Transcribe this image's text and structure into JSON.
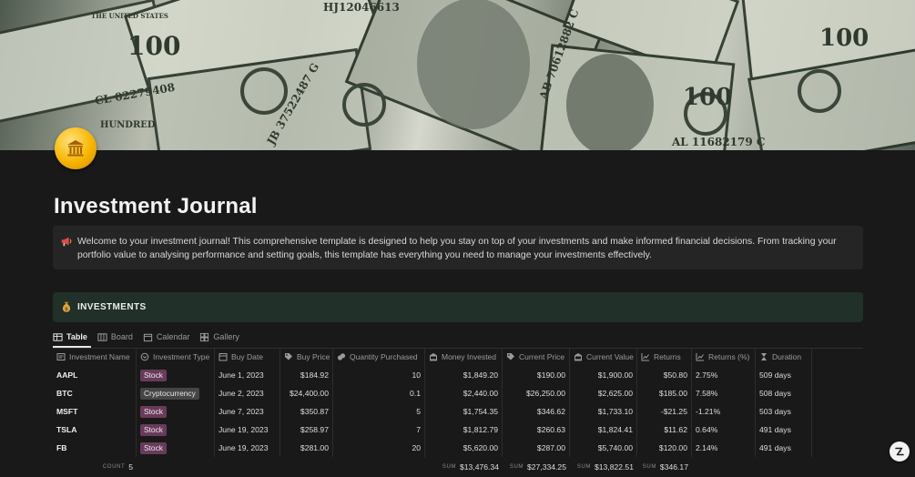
{
  "cover": {
    "banknote_texts": [
      "HJ12046613",
      "THE UNITED STATES",
      "100",
      "CL 02279408",
      "JB 37522487 G",
      "AB 70612882 C",
      "AL 11682179 C",
      "HUNDRED",
      "100",
      "100"
    ]
  },
  "page": {
    "icon": "bank-building-icon",
    "title": "Investment Journal"
  },
  "callout": {
    "icon": "megaphone-icon",
    "text": "Welcome to your investment journal! This comprehensive template is designed to help you stay on top of your investments and make informed financial decisions. From tracking your portfolio value to analysing performance and setting goals, this template has everything you need to manage your investments effectively."
  },
  "section": {
    "icon": "money-bag-icon",
    "label": "INVESTMENTS"
  },
  "views": [
    {
      "label": "Table",
      "icon": "table-icon",
      "active": true
    },
    {
      "label": "Board",
      "icon": "board-icon",
      "active": false
    },
    {
      "label": "Calendar",
      "icon": "calendar-icon",
      "active": false
    },
    {
      "label": "Gallery",
      "icon": "gallery-icon",
      "active": false
    }
  ],
  "columns": [
    {
      "label": "Investment Name",
      "icon": "title-icon"
    },
    {
      "label": "Investment Type",
      "icon": "select-icon"
    },
    {
      "label": "Buy Date",
      "icon": "calendar-icon"
    },
    {
      "label": "Buy Price",
      "icon": "tag-icon"
    },
    {
      "label": "Quantity Purchased",
      "icon": "coins-icon"
    },
    {
      "label": "Money Invested",
      "icon": "bank-icon"
    },
    {
      "label": "Current Price",
      "icon": "tag-icon"
    },
    {
      "label": "Current Value",
      "icon": "bank-icon"
    },
    {
      "label": "Returns",
      "icon": "chart-icon"
    },
    {
      "label": "Returns (%)",
      "icon": "chart-icon"
    },
    {
      "label": "Duration",
      "icon": "hourglass-icon"
    }
  ],
  "rows": [
    {
      "name": "AAPL",
      "type": "Stock",
      "buy_date": "June 1, 2023",
      "buy_price": "$184.92",
      "quantity": "10",
      "invested": "$1,849.20",
      "current_price": "$190.00",
      "current_value": "$1,900.00",
      "returns": "$50.80",
      "returns_pct": "2.75%",
      "duration": "509 days"
    },
    {
      "name": "BTC",
      "type": "Cryptocurrency",
      "buy_date": "June 2, 2023",
      "buy_price": "$24,400.00",
      "quantity": "0.1",
      "invested": "$2,440.00",
      "current_price": "$26,250.00",
      "current_value": "$2,625.00",
      "returns": "$185.00",
      "returns_pct": "7.58%",
      "duration": "508 days"
    },
    {
      "name": "MSFT",
      "type": "Stock",
      "buy_date": "June 7, 2023",
      "buy_price": "$350.87",
      "quantity": "5",
      "invested": "$1,754.35",
      "current_price": "$346.62",
      "current_value": "$1,733.10",
      "returns": "-$21.25",
      "returns_pct": "-1.21%",
      "duration": "503 days"
    },
    {
      "name": "TSLA",
      "type": "Stock",
      "buy_date": "June 19, 2023",
      "buy_price": "$258.97",
      "quantity": "7",
      "invested": "$1,812.79",
      "current_price": "$260.63",
      "current_value": "$1,824.41",
      "returns": "$11.62",
      "returns_pct": "0.64%",
      "duration": "491 days"
    },
    {
      "name": "FB",
      "type": "Stock",
      "buy_date": "June 19, 2023",
      "buy_price": "$281.00",
      "quantity": "20",
      "invested": "$5,620.00",
      "current_price": "$287.00",
      "current_value": "$5,740.00",
      "returns": "$120.00",
      "returns_pct": "2.14%",
      "duration": "491 days"
    }
  ],
  "footer": {
    "count_label": "COUNT",
    "count_value": "5",
    "sum_label": "SUM",
    "invested_sum": "$13,476.34",
    "current_price_sum": "$27,334.25",
    "current_value_sum": "$13,822.51",
    "returns_sum": "$346.17"
  },
  "colors": {
    "background": "#191919",
    "callout": "#252525",
    "section": "#213028",
    "stock_tag": "#683b5a",
    "crypto_tag": "#454545"
  },
  "help_button": {
    "icon": "help-icon"
  }
}
